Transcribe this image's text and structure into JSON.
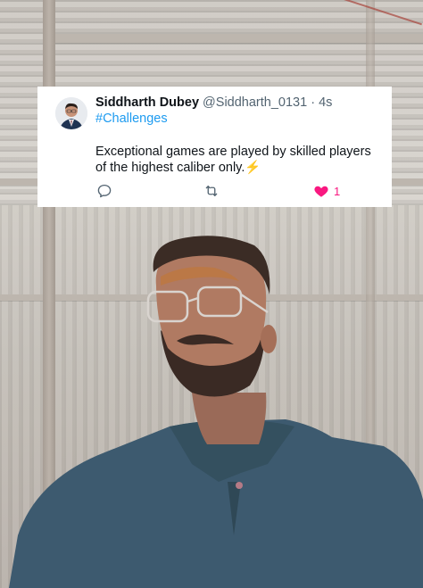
{
  "tweet": {
    "author_name": "Siddharth Dubey",
    "author_handle": "@Siddharth_0131",
    "separator": "·",
    "time_ago": "4s",
    "hashtag": "#Challenges",
    "text": "Exceptional games are played by skilled players of the highest caliber only.",
    "emoji": "⚡",
    "like_count": "1",
    "liked": true
  },
  "icons": {
    "reply": "reply-icon",
    "retweet": "retweet-icon",
    "like": "heart-icon",
    "avatar": "avatar"
  },
  "colors": {
    "hashtag": "#1d9bf0",
    "like": "#f91880",
    "secondary_text": "#536471",
    "primary_text": "#0f1419",
    "shirt": "#3c5a70"
  }
}
